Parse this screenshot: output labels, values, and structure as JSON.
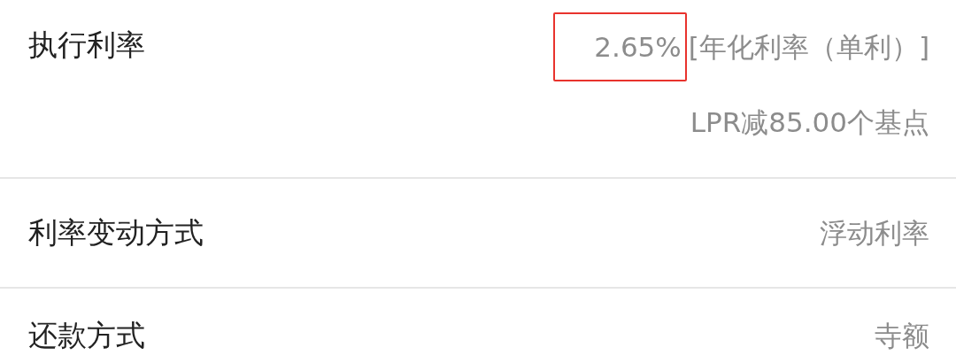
{
  "rows": [
    {
      "label": "执行利率",
      "value_parts": [
        {
          "text": "2.65%",
          "highlighted": true
        },
        {
          "text": "[年化利率（单利）]",
          "highlighted": false
        }
      ],
      "note": "LPR减85.00个基点"
    },
    {
      "label": "利率变动方式",
      "value_parts": [
        {
          "text": "浮动利率",
          "highlighted": false
        }
      ]
    },
    {
      "label": "还款方式",
      "value_parts": [
        {
          "text": "寺额",
          "highlighted": false
        }
      ]
    }
  ]
}
